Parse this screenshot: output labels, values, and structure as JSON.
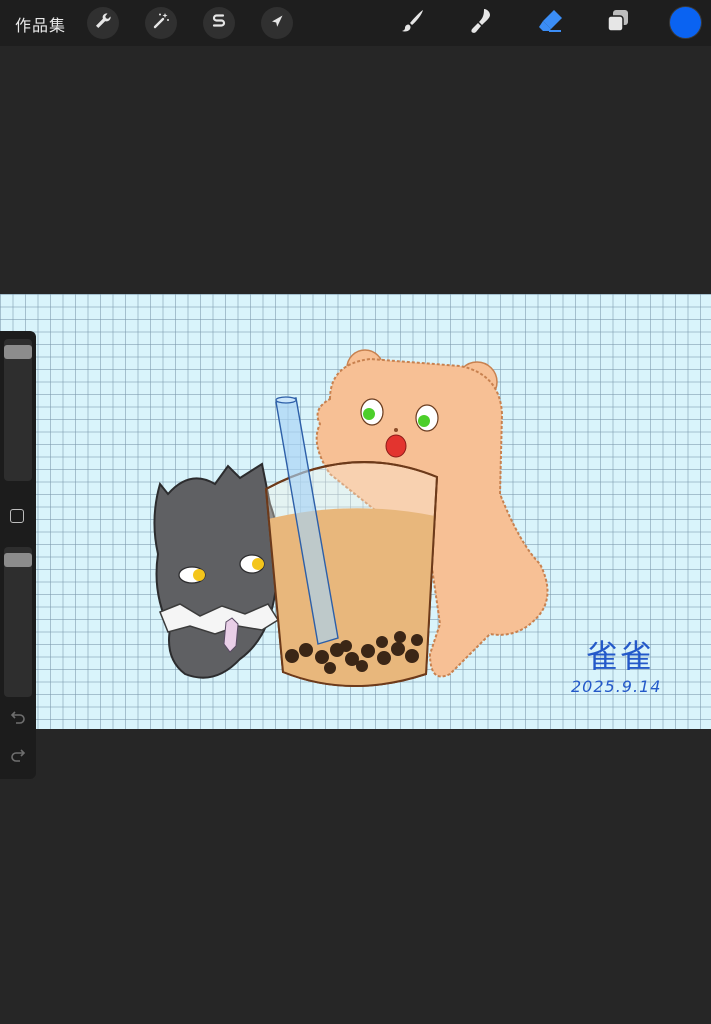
{
  "topbar": {
    "gallery_label": "作品集",
    "actions": [
      {
        "icon": "wrench-icon"
      },
      {
        "icon": "magic-wand-icon"
      },
      {
        "icon": "selection-s-icon"
      },
      {
        "icon": "transform-arrow-icon"
      }
    ],
    "tools": [
      {
        "icon": "brush-icon",
        "active": false
      },
      {
        "icon": "smudge-icon",
        "active": false
      },
      {
        "icon": "eraser-icon",
        "active": true
      },
      {
        "icon": "layers-icon",
        "active": false
      }
    ],
    "current_color": "#0a63f2",
    "active_tool_color": "#3b8df5"
  },
  "canvas": {
    "background_color": "#d9f4fb",
    "grid": true,
    "signature": {
      "name": "雀雀",
      "date": "2025.9.14"
    }
  },
  "sidebar": {
    "brush_size_level": 0.0,
    "opacity_level": 0.0,
    "modify_icon": "square-icon",
    "undo_icon": "undo-icon",
    "redo_icon": "redo-icon"
  }
}
